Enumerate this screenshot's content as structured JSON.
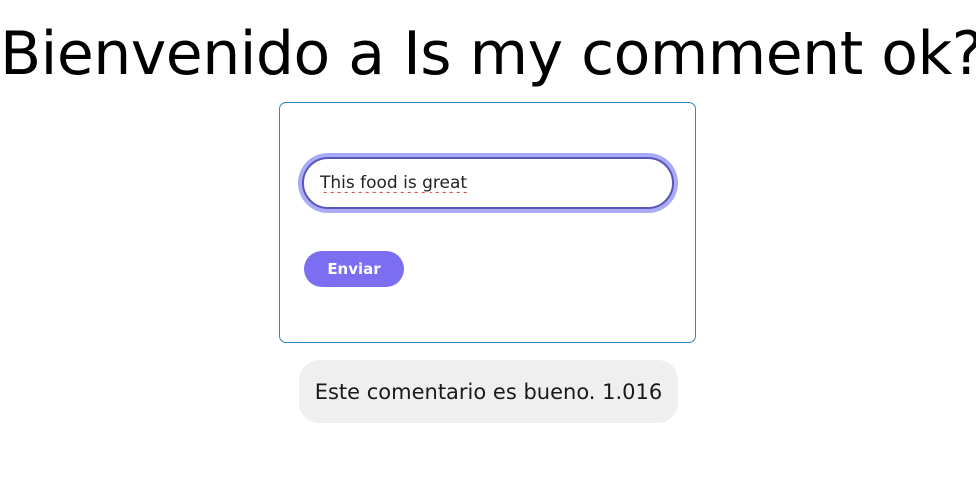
{
  "header": {
    "title": "Bienvenido a Is my comment ok?"
  },
  "form": {
    "comment_value": "This food is great",
    "submit_label": "Enviar"
  },
  "result": {
    "text": "Este comentario es bueno. 1.016"
  },
  "colors": {
    "accent": "#7b6ef0",
    "card_border": "#2a8ab6",
    "input_border": "#5a55b8",
    "focus_ring": "#a9abf6",
    "result_bg": "#efefef"
  }
}
